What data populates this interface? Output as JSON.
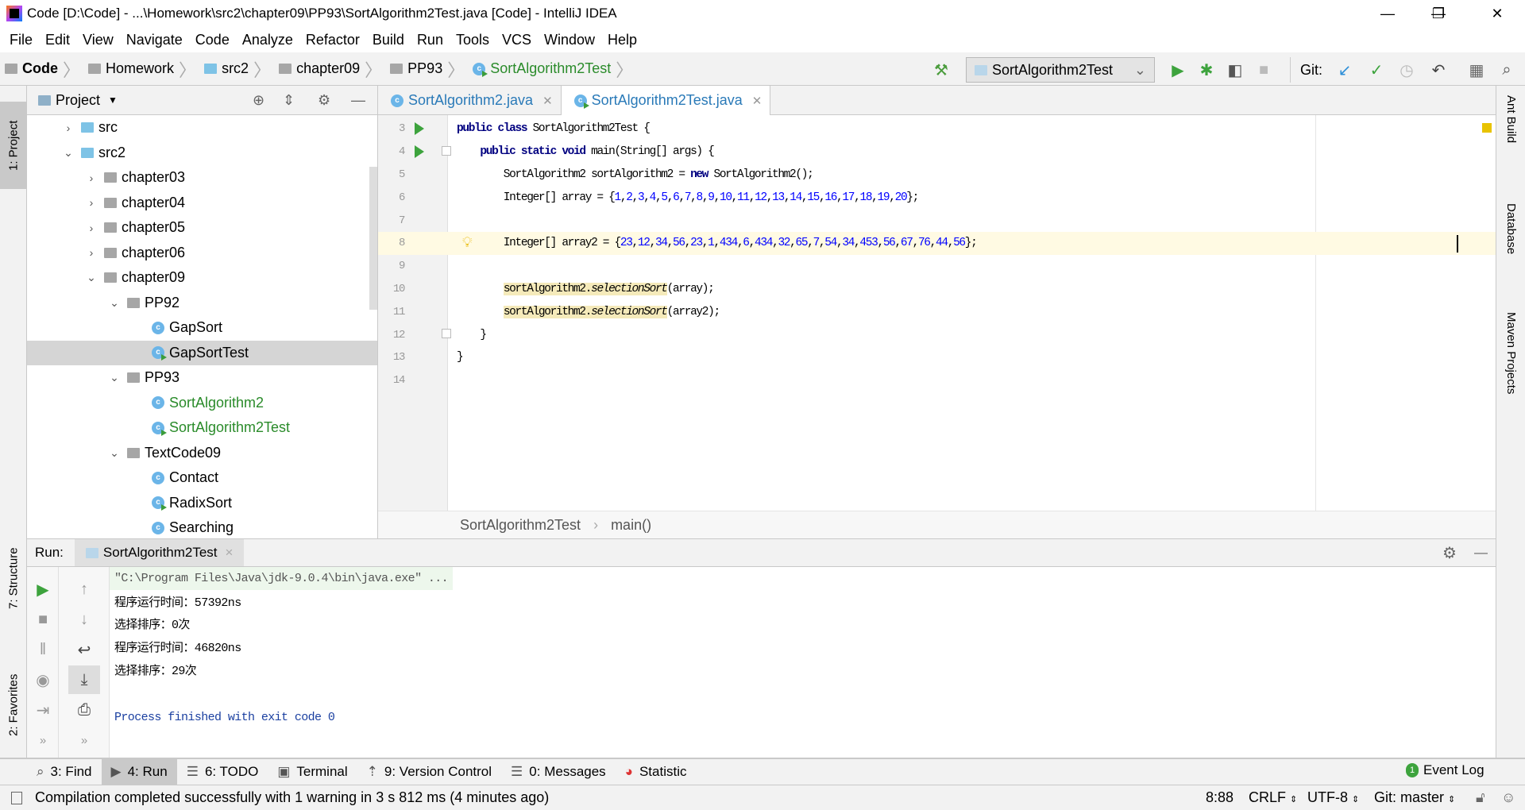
{
  "window": {
    "title": "Code [D:\\Code] - ...\\Homework\\src2\\chapter09\\PP93\\SortAlgorithm2Test.java [Code] - IntelliJ IDEA",
    "minimize": "—",
    "restore": "❐",
    "close": "✕"
  },
  "menu": [
    "File",
    "Edit",
    "View",
    "Navigate",
    "Code",
    "Analyze",
    "Refactor",
    "Build",
    "Run",
    "Tools",
    "VCS",
    "Window",
    "Help"
  ],
  "breadcrumb": [
    {
      "label": "Code",
      "icon": "module-icon"
    },
    {
      "label": "Homework",
      "icon": "folder-icon"
    },
    {
      "label": "src2",
      "icon": "source-folder-icon"
    },
    {
      "label": "chapter09",
      "icon": "package-icon"
    },
    {
      "label": "PP93",
      "icon": "package-icon"
    },
    {
      "label": "SortAlgorithm2Test",
      "icon": "test-class-icon"
    }
  ],
  "toolbar": {
    "run_config": "SortAlgorithm2Test",
    "git_label": "Git:"
  },
  "project": {
    "title": "Project",
    "tree": [
      {
        "label": "src",
        "depth": 0,
        "arrow": "›",
        "icon": "source-folder"
      },
      {
        "label": "src2",
        "depth": 0,
        "arrow": "⌄",
        "icon": "source-folder"
      },
      {
        "label": "chapter03",
        "depth": 1,
        "arrow": "›",
        "icon": "package"
      },
      {
        "label": "chapter04",
        "depth": 1,
        "arrow": "›",
        "icon": "package"
      },
      {
        "label": "chapter05",
        "depth": 1,
        "arrow": "›",
        "icon": "package"
      },
      {
        "label": "chapter06",
        "depth": 1,
        "arrow": "›",
        "icon": "package"
      },
      {
        "label": "chapter09",
        "depth": 1,
        "arrow": "⌄",
        "icon": "package"
      },
      {
        "label": "PP92",
        "depth": 2,
        "arrow": "⌄",
        "icon": "package"
      },
      {
        "label": "GapSort",
        "depth": 3,
        "icon": "class"
      },
      {
        "label": "GapSortTest",
        "depth": 3,
        "icon": "test-class",
        "selected": true
      },
      {
        "label": "PP93",
        "depth": 2,
        "arrow": "⌄",
        "icon": "package"
      },
      {
        "label": "SortAlgorithm2",
        "depth": 3,
        "icon": "class",
        "modified": true
      },
      {
        "label": "SortAlgorithm2Test",
        "depth": 3,
        "icon": "test-class",
        "modified": true
      },
      {
        "label": "TextCode09",
        "depth": 2,
        "arrow": "⌄",
        "icon": "package"
      },
      {
        "label": "Contact",
        "depth": 3,
        "icon": "class"
      },
      {
        "label": "RadixSort",
        "depth": 3,
        "icon": "test-class"
      },
      {
        "label": "Searching",
        "depth": 3,
        "icon": "class"
      }
    ]
  },
  "editor": {
    "tabs": [
      {
        "label": "SortAlgorithm2.java",
        "active": false
      },
      {
        "label": "SortAlgorithm2Test.java",
        "active": true
      }
    ],
    "current_line": 8,
    "lines": [
      {
        "n": "3",
        "run": true,
        "tokens": [
          [
            "kw",
            "public class "
          ],
          [
            "",
            "SortAlgorithm2Test {"
          ]
        ]
      },
      {
        "n": "4",
        "run": true,
        "tokens": [
          [
            "",
            "    "
          ],
          [
            "kw",
            "public static void "
          ],
          [
            "",
            "main(String[] args) {"
          ]
        ]
      },
      {
        "n": "5",
        "tokens": [
          [
            "",
            "        SortAlgorithm2 sortAlgorithm2 = "
          ],
          [
            "kw",
            "new "
          ],
          [
            "",
            "SortAlgorithm2();"
          ]
        ]
      },
      {
        "n": "6",
        "tokens": [
          [
            "",
            "        Integer[] array = {"
          ],
          [
            "num",
            "1"
          ],
          [
            "",
            ","
          ],
          [
            "num",
            "2"
          ],
          [
            "",
            ","
          ],
          [
            "num",
            "3"
          ],
          [
            "",
            ","
          ],
          [
            "num",
            "4"
          ],
          [
            "",
            ","
          ],
          [
            "num",
            "5"
          ],
          [
            "",
            ","
          ],
          [
            "num",
            "6"
          ],
          [
            "",
            ","
          ],
          [
            "num",
            "7"
          ],
          [
            "",
            ","
          ],
          [
            "num",
            "8"
          ],
          [
            "",
            ","
          ],
          [
            "num",
            "9"
          ],
          [
            "",
            ","
          ],
          [
            "num",
            "10"
          ],
          [
            "",
            ","
          ],
          [
            "num",
            "11"
          ],
          [
            "",
            ","
          ],
          [
            "num",
            "12"
          ],
          [
            "",
            ","
          ],
          [
            "num",
            "13"
          ],
          [
            "",
            ","
          ],
          [
            "num",
            "14"
          ],
          [
            "",
            ","
          ],
          [
            "num",
            "15"
          ],
          [
            "",
            ","
          ],
          [
            "num",
            "16"
          ],
          [
            "",
            ","
          ],
          [
            "num",
            "17"
          ],
          [
            "",
            ","
          ],
          [
            "num",
            "18"
          ],
          [
            "",
            ","
          ],
          [
            "num",
            "19"
          ],
          [
            "",
            ","
          ],
          [
            "num",
            "20"
          ],
          [
            "",
            "};"
          ]
        ]
      },
      {
        "n": "7",
        "tokens": []
      },
      {
        "n": "8",
        "bulb": true,
        "tokens": [
          [
            "",
            "        Integer[] array2 = {"
          ],
          [
            "num",
            "23"
          ],
          [
            "",
            ","
          ],
          [
            "num",
            "12"
          ],
          [
            "",
            ","
          ],
          [
            "num",
            "34"
          ],
          [
            "",
            ","
          ],
          [
            "num",
            "56"
          ],
          [
            "",
            ","
          ],
          [
            "num",
            "23"
          ],
          [
            "",
            ","
          ],
          [
            "num",
            "1"
          ],
          [
            "",
            ","
          ],
          [
            "num",
            "434"
          ],
          [
            "",
            ","
          ],
          [
            "num",
            "6"
          ],
          [
            "",
            ","
          ],
          [
            "num",
            "434"
          ],
          [
            "",
            ","
          ],
          [
            "num",
            "32"
          ],
          [
            "",
            ","
          ],
          [
            "num",
            "65"
          ],
          [
            "",
            ","
          ],
          [
            "num",
            "7"
          ],
          [
            "",
            ","
          ],
          [
            "num",
            "54"
          ],
          [
            "",
            ","
          ],
          [
            "num",
            "34"
          ],
          [
            "",
            ","
          ],
          [
            "num",
            "453"
          ],
          [
            "",
            ","
          ],
          [
            "num",
            "56"
          ],
          [
            "",
            ","
          ],
          [
            "num",
            "67"
          ],
          [
            "",
            ","
          ],
          [
            "num",
            "76"
          ],
          [
            "",
            ","
          ],
          [
            "num",
            "44"
          ],
          [
            "",
            ","
          ],
          [
            "num",
            "56"
          ],
          [
            "",
            "};"
          ]
        ]
      },
      {
        "n": "9",
        "tokens": []
      },
      {
        "n": "10",
        "tokens": [
          [
            "",
            "        "
          ],
          [
            "hl",
            "sortAlgorithm2."
          ],
          [
            "hl it",
            "selectionSort"
          ],
          [
            "",
            "(array);"
          ]
        ]
      },
      {
        "n": "11",
        "tokens": [
          [
            "",
            "        "
          ],
          [
            "hl",
            "sortAlgorithm2."
          ],
          [
            "hl it",
            "selectionSort"
          ],
          [
            "",
            "(array2);"
          ]
        ]
      },
      {
        "n": "12",
        "tokens": [
          [
            "",
            "    }"
          ]
        ]
      },
      {
        "n": "13",
        "tokens": [
          [
            "",
            "}"
          ]
        ]
      },
      {
        "n": "14",
        "tokens": []
      }
    ],
    "breadcrumb": [
      "SortAlgorithm2Test",
      "main()"
    ]
  },
  "run": {
    "label": "Run:",
    "tab": "SortAlgorithm2Test",
    "output": [
      {
        "text": "\"C:\\Program Files\\Java\\jdk-9.0.4\\bin\\java.exe\" ...",
        "kind": "cmd"
      },
      {
        "text": "程序运行时间：57392ns",
        "kind": "out"
      },
      {
        "text": "选择排序：0次",
        "kind": "out"
      },
      {
        "text": "程序运行时间：46820ns",
        "kind": "out"
      },
      {
        "text": "选择排序：29次",
        "kind": "out"
      },
      {
        "text": "",
        "kind": "out"
      },
      {
        "text": "Process finished with exit code 0",
        "kind": "exit"
      }
    ]
  },
  "side": {
    "left": [
      "1: Project",
      "7: Structure",
      "2: Favorites"
    ],
    "right": [
      "Ant Build",
      "Database",
      "Maven Projects"
    ]
  },
  "tooltabs": [
    {
      "label": "3: Find",
      "icon": "search-icon"
    },
    {
      "label": "4: Run",
      "icon": "run-icon",
      "active": true
    },
    {
      "label": "6: TODO",
      "icon": "todo-icon"
    },
    {
      "label": "Terminal",
      "icon": "terminal-icon"
    },
    {
      "label": "9: Version Control",
      "icon": "vcs-icon"
    },
    {
      "label": "0: Messages",
      "icon": "messages-icon"
    },
    {
      "label": "Statistic",
      "icon": "statistic-icon"
    }
  ],
  "event_log": {
    "label": "Event Log",
    "count": "1"
  },
  "status": {
    "message": "Compilation completed successfully with 1 warning in 3 s 812 ms (4 minutes ago)",
    "position": "8:88",
    "line_sep": "CRLF",
    "encoding": "UTF-8",
    "git": "Git: master"
  },
  "colors": {
    "keyword": "#000080",
    "number": "#0000ff",
    "run_green": "#3da33d",
    "current_line": "#fffae3",
    "usage_highlight": "#f5eaba"
  }
}
